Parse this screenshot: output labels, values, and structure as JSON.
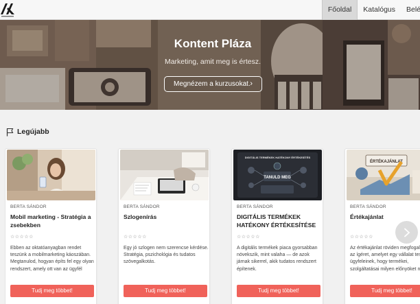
{
  "colors": {
    "accent_button": "#f0625a",
    "nav_active_bg": "#d9d9d9",
    "page_bg": "#f1f1f1"
  },
  "header": {
    "logo_icon": "brand-logo-icon",
    "nav": [
      {
        "label": "Főoldal",
        "active": true
      },
      {
        "label": "Katalógus",
        "active": false
      },
      {
        "label": "Belépés",
        "active": false
      }
    ]
  },
  "hero": {
    "title": "Kontent Pláza",
    "subtitle": "Marketing, amit meg is értesz.",
    "button_label": "Megnézem a kurzusokat.",
    "button_icon": "chevron-right-icon"
  },
  "section": {
    "icon": "flag-icon",
    "title": "Legújabb"
  },
  "cards": [
    {
      "author": "BERTA SÁNDOR",
      "title": "Mobil marketing - Stratégia a zsebekben",
      "rating": "☆☆☆☆☆",
      "description": "Ebben az oktatóanyagban rendet teszünk a mobilmarketing káoszában. Megtanulod, hogyan építs fel egy olyan rendszert, amely ott van az ügyfél",
      "button": "Tudj meg többet!"
    },
    {
      "author": "BERTA SÁNDOR",
      "title": "Szlogenírás",
      "rating": "☆☆☆☆☆",
      "description": "Egy jó szlogen nem szerencse kérdése. Stratégia, pszichológia és tudatos szövegalkotás.",
      "button": "Tudj meg többet!"
    },
    {
      "author": "BERTA SÁNDOR",
      "title": "DIGITÁLIS TERMÉKEK HATÉKONY ÉRTÉKESÍTÉSE",
      "rating": "☆☆☆☆☆",
      "description": "A digitális termékek piaca gyorsabban növekszik, mint valaha — de azok járnak sikerrel, akik tudatos rendszert építenek.",
      "button": "Tudj meg többet!"
    },
    {
      "author": "BERTA SÁNDOR",
      "title": "Értékajánlat",
      "rating": "☆☆☆☆☆",
      "description": "Az értékajánlat röviden megfogalmazva az ígéret, amelyet egy vállalat tesz ügyfeleinek, hogy termékei, szolgáltatásai milyen előnyöket nyúj",
      "button": "Tudj meg többet!"
    }
  ],
  "card_image_texts": {
    "card3_heading": "DIGITÁLIS TERMÉKEK HATÉKONY ÉRTÉKESÍTÉS",
    "card3_badge": "TANULD MEG",
    "card4_sign": "ÉRTÉKAJÁNLAT"
  },
  "carousel": {
    "next_icon": "chevron-right-icon"
  }
}
